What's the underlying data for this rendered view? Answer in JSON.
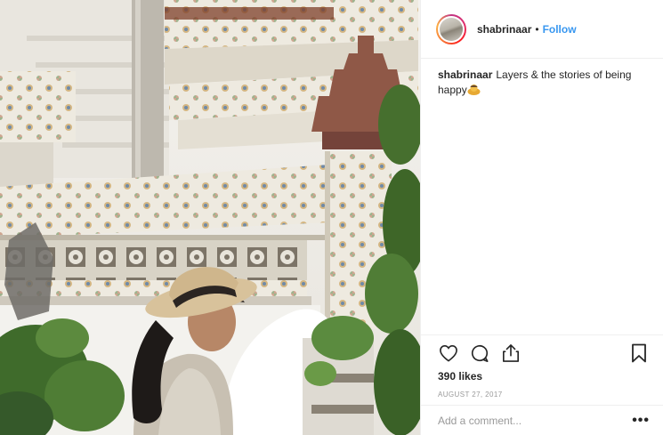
{
  "post": {
    "username": "shabrinaar",
    "separator": "•",
    "follow_label": "Follow",
    "caption_username": "shabrinaar",
    "caption_text": "Layers & the stories of being happy",
    "caption_emoji": "person-bowing",
    "likes": "390 likes",
    "date": "AUGUST 27, 2017",
    "comment_placeholder": "Add a comment...",
    "more_label": "•••"
  },
  "icons": {
    "like": "heart-icon",
    "comment": "speech-bubble-icon",
    "share": "share-icon",
    "save": "bookmark-icon",
    "emoji": "bowing-emoji-icon"
  },
  "colors": {
    "link_blue": "#3897f0",
    "text": "#262626",
    "muted": "#999999",
    "divider": "#efefef"
  }
}
